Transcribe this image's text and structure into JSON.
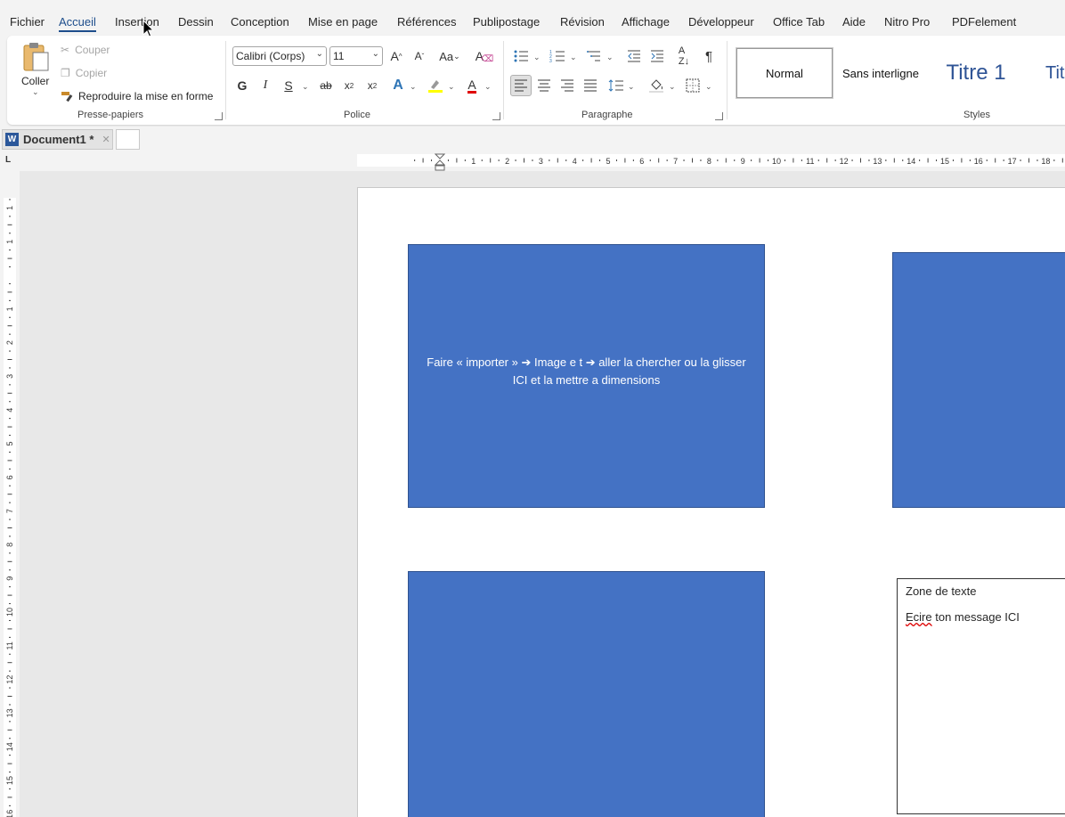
{
  "menu": {
    "tabs": [
      "Fichier",
      "Accueil",
      "Insertion",
      "Dessin",
      "Conception",
      "Mise en page",
      "Références",
      "Publipostage",
      "Révision",
      "Affichage",
      "Développeur",
      "Office Tab",
      "Aide",
      "Nitro Pro",
      "PDFelement"
    ],
    "active": "Accueil"
  },
  "clipboard": {
    "paste_label": "Coller",
    "cut_label": "Couper",
    "copy_label": "Copier",
    "format_painter_label": "Reproduire la mise en forme",
    "group_label": "Presse-papiers"
  },
  "font": {
    "family": "Calibri (Corps)",
    "size": "11",
    "bold": "G",
    "italic": "I",
    "underline": "S",
    "group_label": "Police",
    "highlight_color": "#ffff00",
    "font_color": "#e00000"
  },
  "paragraph": {
    "group_label": "Paragraphe"
  },
  "styles": {
    "items": [
      "Normal",
      "Sans interligne",
      "Titre 1",
      "Tit"
    ],
    "group_label": "Styles"
  },
  "document_tab": {
    "title": "Document1 *"
  },
  "ruler": {
    "h_numbers": [
      "1",
      "1",
      "2",
      "3",
      "4",
      "5",
      "6",
      "7",
      "8",
      "9",
      "10",
      "11",
      "12",
      "13",
      "14",
      "15",
      "16",
      "17",
      "18"
    ],
    "v_numbers": [
      "1",
      "1",
      "2",
      "3",
      "4",
      "5",
      "6",
      "7",
      "8",
      "9",
      "10",
      "11",
      "12",
      "13",
      "14",
      "15"
    ]
  },
  "document": {
    "shape1_text": "Faire « importer » ➔ Image e t ➔     aller la chercher ou la glisser ICI et la mettre a dimensions",
    "textbox_title": "Zone de texte",
    "textbox_word1": "Ecire",
    "textbox_rest": " ton message ICI",
    "shape_color": "#4472c4"
  }
}
